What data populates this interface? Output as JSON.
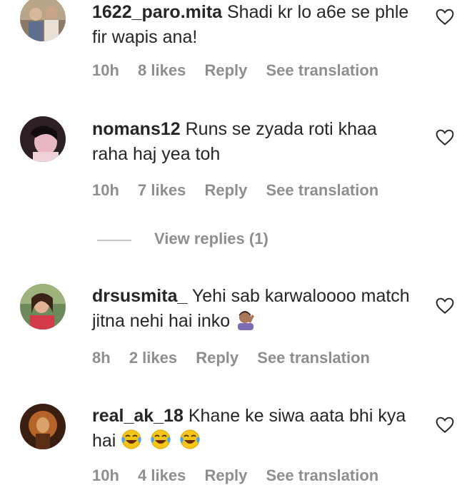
{
  "comments": [
    {
      "username": "1622_paro.mita",
      "text": "Shadi kr lo a6e se phle fir wapis ana!",
      "time": "10h",
      "likes": "8 likes",
      "reply": "Reply",
      "translate": "See translation"
    },
    {
      "username": "nomans12",
      "text": "Runs se zyada roti khaa raha haj yea toh",
      "time": "10h",
      "likes": "7 likes",
      "reply": "Reply",
      "translate": "See translation"
    },
    {
      "username": "drsusmita_",
      "text": "Yehi sab karwaloooo match jitna nehi hai inko",
      "time": "8h",
      "likes": "2 likes",
      "reply": "Reply",
      "translate": "See translation"
    },
    {
      "username": "real_ak_18",
      "text": "Khane ke siwa aata bhi kya hai",
      "time": "10h",
      "likes": "4 likes",
      "reply": "Reply",
      "translate": "See translation"
    }
  ],
  "view_replies": "View replies (1)",
  "icons": {
    "like": "heart-outline-icon",
    "facepalm": "person-facepalming-emoji",
    "laugh": "face-with-tears-of-joy-emoji"
  },
  "colors": {
    "text": "#262626",
    "muted": "#8e8e8e",
    "laugh_emoji": "#f5c518"
  }
}
